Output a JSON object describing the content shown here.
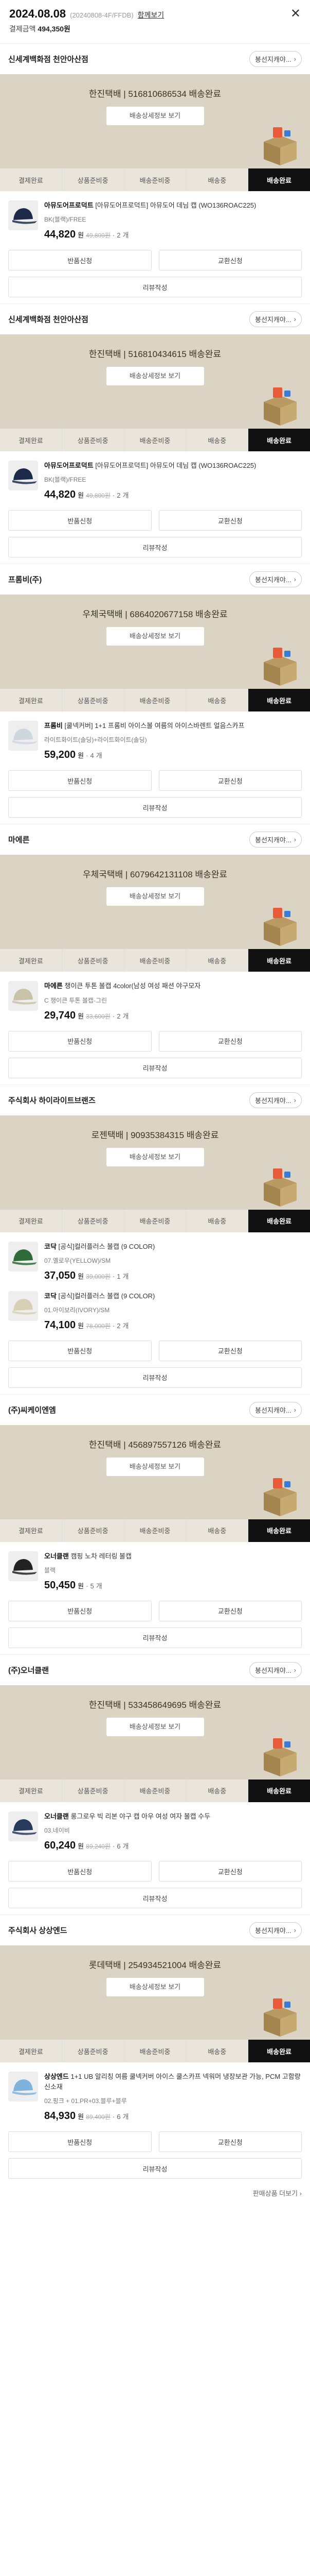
{
  "header": {
    "date": "2024.08.08",
    "order_no": "(20240808-4F/FFDB)",
    "combine_link": "함께보기",
    "close": "✕",
    "total_label": "결제금액",
    "total_value": "494,350원"
  },
  "labels": {
    "chat": "봉선지캐야...",
    "chat_arrow": "›",
    "track_btn": "배송상세정보 보기",
    "steps": [
      "결제완료",
      "상품준비중",
      "배송준비중",
      "배송중",
      "배송완료"
    ],
    "exchange": "교환신청",
    "return": "반품신청",
    "review": "리뷰작성",
    "count_suffix": "개",
    "won": "원"
  },
  "sections": [
    {
      "seller": "신세계백화점 천안아산점",
      "tracking": "한진택배 | 516810686534 배송완료",
      "items": [
        {
          "brand": "아뮤도어프로덕트",
          "name": "[아뮤도어프로덕트] 아뮤도어 데님 캡 (WO136ROAC225)",
          "option": "BK(블랙)/FREE",
          "price": "44,820",
          "was": "49,800원",
          "qty": "2",
          "color": "#1d2a4a"
        }
      ]
    },
    {
      "seller": "신세계백화점 천안아산점",
      "tracking": "한진택배 | 516810434615 배송완료",
      "items": [
        {
          "brand": "아뮤도어프로덕트",
          "name": "[아뮤도어프로덕트] 아뮤도어 데님 캡 (WO136ROAC225)",
          "option": "BK(블랙)/FREE",
          "price": "44,820",
          "was": "49,800원",
          "qty": "2",
          "color": "#1d2a4a"
        }
      ]
    },
    {
      "seller": "프롬비(주)",
      "tracking": "우체국택배 | 6864020677158 배송완료",
      "items": [
        {
          "brand": "프롬비",
          "name": "[쿨넥커버] 1+1 프롬비 아이스볼 여름의 아이스바렌트 얼음스카프",
          "option": "라이트화이트(솔딩)+라이트화이트(솔딩)",
          "price": "59,200",
          "was": "",
          "qty": "4",
          "color": "#cfd6de"
        }
      ]
    },
    {
      "seller": "마에른",
      "tracking": "우체국택배 | 6079642131108 배송완료",
      "items": [
        {
          "brand": "마에른",
          "name": "챙이큰 투톤 볼캡 4color(남성 여성 패션 야구모자",
          "option": "C 챙이큰 투톤 볼캡-그린",
          "price": "29,740",
          "was": "33,600원",
          "qty": "2",
          "color": "#c8c2a8"
        }
      ]
    },
    {
      "seller": "주식회사 하이라이트브랜즈",
      "tracking": "로젠택배 | 90935384315 배송완료",
      "items": [
        {
          "brand": "코닥",
          "name": "[공식]컬러플러스 볼캡 (9 COLOR)",
          "option": "07.옐로우(YELLOW)/SM",
          "price": "37,050",
          "was": "39,000원",
          "qty": "1",
          "color": "#2f6a3b"
        },
        {
          "brand": "코닥",
          "name": "[공식]컬러플러스 볼캡 (9 COLOR)",
          "option": "01.아이보리(IVORY)/SM",
          "price": "74,100",
          "was": "78,000원",
          "qty": "2",
          "color": "#d7cfb6"
        }
      ]
    },
    {
      "seller": "(주)씨케이엔엠",
      "tracking": "한진택배 | 456897557126 배송완료",
      "items": [
        {
          "brand": "오너클랜",
          "name": "캠핑 노차 레터링 볼캡",
          "option": "블랙",
          "price": "50,450",
          "was": "",
          "qty": "5",
          "color": "#222"
        }
      ]
    },
    {
      "seller": "(주)오너클랜",
      "tracking": "한진택배 | 533458649695 배송완료",
      "items": [
        {
          "brand": "오너클랜",
          "name": "롱그로우 빅 리본 야구 캡 아우 여성 여자 볼캡 수두",
          "option": "03.네이비",
          "price": "60,240",
          "was": "89,240원",
          "qty": "6",
          "color": "#283a5c"
        }
      ]
    },
    {
      "seller": "주식회사 상상엔드",
      "tracking": "롯데택배 | 254934521004 배송완료",
      "items": [
        {
          "brand": "상상엔드",
          "name": "1+1 UB 알리칭 여름 쿨넥커버 아이스 쿨스카프 넥워머 냉장보관 가능, PCM 고함량 신소재",
          "option": "02.핑크 + 01.PR+03.블루+블루",
          "price": "84,930",
          "was": "89,400원",
          "qty": "6",
          "color": "#7fb2dc"
        }
      ]
    }
  ],
  "footer": {
    "text": "판매상품 더보기 ›"
  }
}
